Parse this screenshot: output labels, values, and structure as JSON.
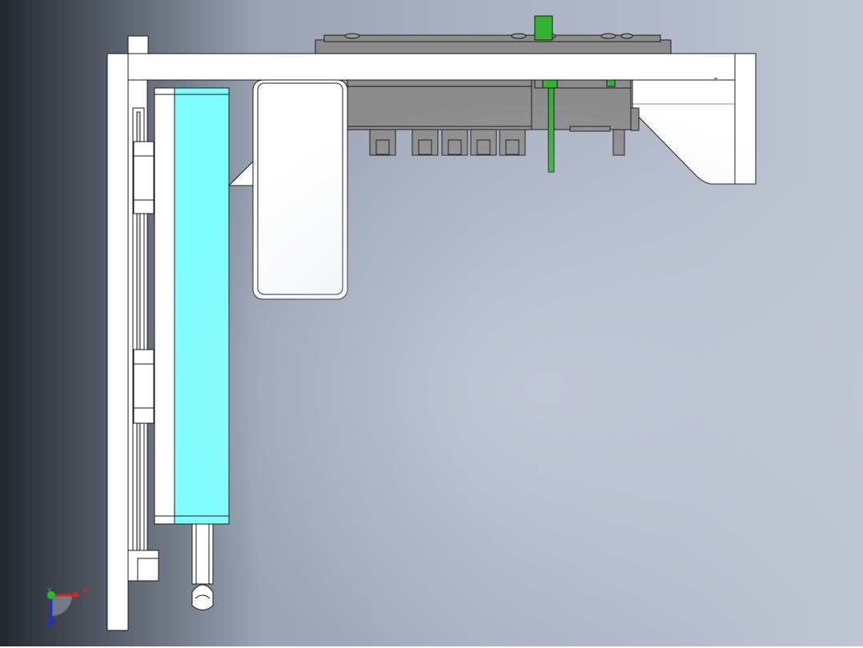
{
  "viewport": {
    "background_dark": "#24282e",
    "background_light": "#bfc6d3"
  },
  "model": {
    "part_fill": "#ffffff",
    "part_stroke": "#1a1a1a",
    "dark_part_fill": "#8c8c8c",
    "accent_cyan": "#80ffff",
    "accent_green": "#33b233"
  },
  "triad": {
    "x_label": "X",
    "y_label": "Y",
    "z_label": "Z",
    "x_color": "#e02020",
    "y_color": "#20c020",
    "z_color": "#2030d0"
  }
}
